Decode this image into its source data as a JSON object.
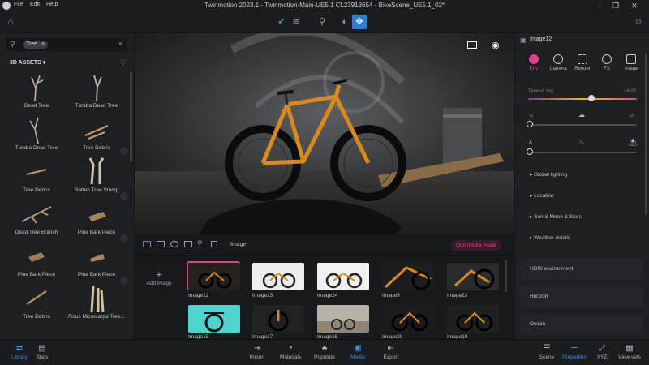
{
  "titlebar": {
    "menu": [
      "File",
      "Edit",
      "Help"
    ],
    "title": "Twinmotion 2023.1 - Twinmotion-Main-UE5.1 CL23913654 - BikeScene_UE5.1_02*"
  },
  "library": {
    "search_tag": "Tree",
    "section_label": "3D ASSETS",
    "assets": [
      "Dead Tree",
      "Tundra Dead Tree",
      "Tundra Dead Tree",
      "Tree Debris",
      "Tree Debris",
      "Rotten Tree Stump",
      "Dead Tree Branch",
      "Pine Bark Piece",
      "Pine Bark Piece",
      "Pine Bark Piece",
      "Tree Debris",
      "Ficus Microcarpa Tree..."
    ]
  },
  "media": {
    "mode_label": "Image",
    "exit_button": "Quit media mode",
    "add_label": "Add image",
    "row1": [
      "Image12",
      "Image23",
      "Image24",
      "Image9",
      "Image23"
    ],
    "row2": [
      "Image18",
      "Image17",
      "Image15",
      "Image20",
      "Image19"
    ]
  },
  "properties": {
    "panel_title": "Image12",
    "tabs": [
      "Env",
      "Camera",
      "Render",
      "FX",
      "Image"
    ],
    "time_of_day_label": "Time of day",
    "time_value": "16:00",
    "sections": [
      "Global lighting",
      "Location",
      "Sun & Moon & Stars",
      "Weather details"
    ],
    "cards": [
      "HDRI environment",
      "Horizon",
      "Ocean"
    ]
  },
  "bottombar": {
    "left": [
      "Library",
      "Stats"
    ],
    "center": [
      "Import",
      "Materials",
      "Populate",
      "Media",
      "Export"
    ],
    "right": [
      "Scene",
      "Properties",
      "XYZ",
      "View sets"
    ]
  },
  "colors": {
    "accent": "#3d8ee6",
    "selection": "#e0408a",
    "bike_orange": "#d98a1c"
  }
}
